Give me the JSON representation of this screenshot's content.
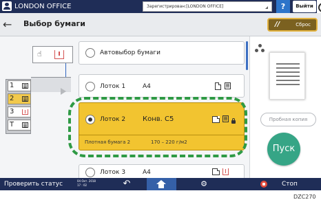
{
  "topbar": {
    "title": "LONDON OFFICE",
    "login_status": "Зарегистрирован:[LONDON OFFICE]",
    "help_label": "?",
    "logout_label": "Выйти",
    "icons": {
      "user": "user-icon",
      "extra": "power-icon"
    }
  },
  "header": {
    "back_icon": "←",
    "title": "Выбор бумаги",
    "reset_icon": "//",
    "reset_label": "Сброс"
  },
  "diagram": {
    "icons": {
      "manual_feed": "hand-icon",
      "bypass": "bypass-tray-icon",
      "paper_path": "arrow-icon"
    },
    "trays": [
      {
        "label": "1",
        "selected": false,
        "icon": "paper-stack-icon"
      },
      {
        "label": "2",
        "selected": true,
        "icon": "paper-stack-icon"
      },
      {
        "label": "3",
        "selected": false,
        "icon": "paper-low-icon"
      },
      {
        "label": "T",
        "selected": false,
        "icon": "paper-stack-icon"
      }
    ]
  },
  "options": [
    {
      "label": "Автовыбор бумаги",
      "size": "",
      "selected": false
    },
    {
      "label": "Лоток 1",
      "size": "A4",
      "selected": false,
      "icons": [
        "paper-portrait-icon",
        "paper-stack-icon"
      ]
    },
    {
      "label": "Лоток 2",
      "size": "Конв. C5",
      "selected": true,
      "icons": [
        "paper-landscape-icon",
        "paper-stack-icon",
        "lock-icon"
      ],
      "paper_type": "Плотная бумага 2",
      "paper_weight": "170 – 220 г/м2"
    },
    {
      "label": "Лоток 3",
      "size": "A4",
      "selected": false,
      "icons": [
        "paper-landscape-icon",
        "paper-low-icon"
      ]
    }
  ],
  "right_panel": {
    "icons": {
      "fit": "multi-dot-icon",
      "preview": "page-preview-icon"
    },
    "proof_copy_label": "Пробная копия",
    "start_label": "Пуск"
  },
  "bottombar": {
    "status_label": "Проверить статус",
    "date": "04 Окт. 2018",
    "time": "17 : 02",
    "back_icon": "↶",
    "home_icon": "home-icon",
    "settings_icon": "⚙",
    "stop_label": "Стоп"
  },
  "colors": {
    "topbar": "#1f2d57",
    "selected_tray": "#f2c430",
    "highlight_outline": "#2f9a45",
    "start_button": "#36a586",
    "reset_border": "#e3b340",
    "stop": "#e24a3a"
  },
  "figure_id": "DZC270"
}
